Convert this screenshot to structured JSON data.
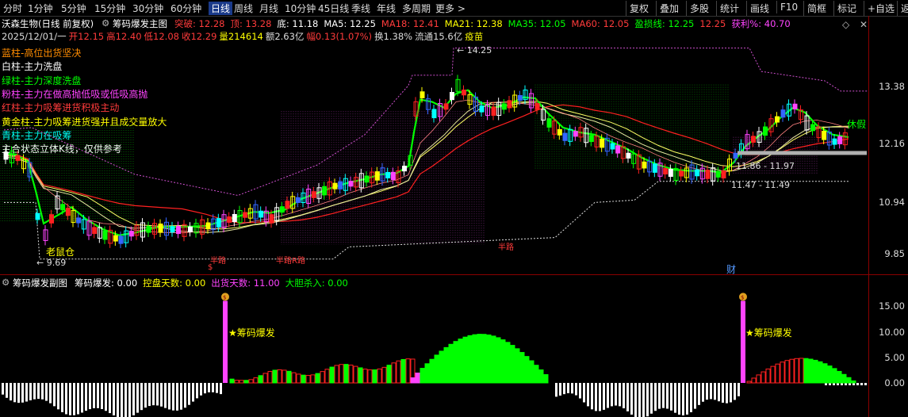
{
  "toolbar": {
    "left": [
      "分时",
      "1分钟",
      "5分钟",
      "15分钟",
      "30分钟",
      "60分钟",
      "日线",
      "周线",
      "月线",
      "10分钟",
      "45日线",
      "季线",
      "年线",
      "多周期",
      "更多 >"
    ],
    "active": "日线",
    "right": [
      "复权",
      "叠加",
      "多股",
      "统计",
      "画线",
      "F10",
      "简框",
      "标记",
      "+自选",
      "返回"
    ]
  },
  "header": {
    "stock": "沃森生物(日线 前复权)",
    "indicator": "筹码爆发主图",
    "params": [
      {
        "t": "突破: 12.28",
        "c": "#ff3b3b"
      },
      {
        "t": "顶: 13.28",
        "c": "#ff3b3b"
      },
      {
        "t": "底: 11.18",
        "c": "#ffffff"
      },
      {
        "t": "MA5: 12.25",
        "c": "#ffffff"
      },
      {
        "t": "MA18: 12.41",
        "c": "#ff3b3b"
      },
      {
        "t": "MA21: 12.38",
        "c": "#ffff00"
      },
      {
        "t": "MA35: 12.05",
        "c": "#00ff00"
      },
      {
        "t": "MA60: 12.05",
        "c": "#ff3b3b"
      },
      {
        "t": "盈损线: 12.25",
        "c": "#00ff00"
      },
      {
        "t": "12.25",
        "c": "#ff3b3b"
      },
      {
        "t": "获利%: 40.70",
        "c": "#ff44ff"
      }
    ],
    "quote": [
      {
        "t": "2025/12/01/一",
        "c": "#ddd"
      },
      {
        "t": "开12.15",
        "c": "#ff3b3b"
      },
      {
        "t": "高12.40",
        "c": "#ff3b3b"
      },
      {
        "t": "低12.08",
        "c": "#ff3b3b"
      },
      {
        "t": "收12.29",
        "c": "#ff3b3b"
      },
      {
        "t": "量214614",
        "c": "#ffff00"
      },
      {
        "t": "额2.63亿",
        "c": "#ddd"
      },
      {
        "t": "幅0.13(1.07%)",
        "c": "#ff3b3b"
      },
      {
        "t": "换1.38%",
        "c": "#ddd"
      },
      {
        "t": "流通15.6亿",
        "c": "#ddd"
      },
      {
        "t": "疫苗",
        "c": "#ffff00"
      }
    ]
  },
  "legend": [
    {
      "t": "蓝柱-高位出货坚决",
      "c": "#ff8c00"
    },
    {
      "t": "白柱-主力洗盘",
      "c": "#ffffff"
    },
    {
      "t": "绿柱-主力深度洗盘",
      "c": "#00ff00"
    },
    {
      "t": "粉柱-主力在做高抛低吸或低吸高抛",
      "c": "#ff44ff"
    },
    {
      "t": "红柱-主力吸筹进货积极主动",
      "c": "#ff3b3b"
    },
    {
      "t": "黄金柱-主力吸筹进货强并且成交量放大",
      "c": "#ffff00"
    },
    {
      "t": "青柱-主力在吸筹",
      "c": "#00ffff"
    },
    {
      "t": "主合状态立体K线，仅供参考",
      "c": "#ffffff"
    }
  ],
  "main_axis": [
    "13.38",
    "12.16",
    "10.94",
    "9.85"
  ],
  "annotations": {
    "high": "14.25",
    "low": "9.69",
    "range1": "11.86 - 11.97",
    "range2": "11.47 - 11.49",
    "xiujia": "休假",
    "laoshu": "老鼠仓",
    "cai": "财",
    "banlu": "半路",
    "banlu2": "半路R路",
    "banlu3": "半路"
  },
  "sub": {
    "title": "筹码爆发副图",
    "params": [
      {
        "t": "筹码爆发: 0.00",
        "c": "#ffffff"
      },
      {
        "t": "控盘天数: 0.00",
        "c": "#ffff00"
      },
      {
        "t": "出货天数: 11.00",
        "c": "#ff44ff"
      },
      {
        "t": "大胆杀入: 0.00",
        "c": "#00ff00"
      }
    ],
    "axis": [
      "15.00",
      "10.00",
      "5.00",
      "0.00"
    ],
    "signal": "★筹码爆发"
  }
}
